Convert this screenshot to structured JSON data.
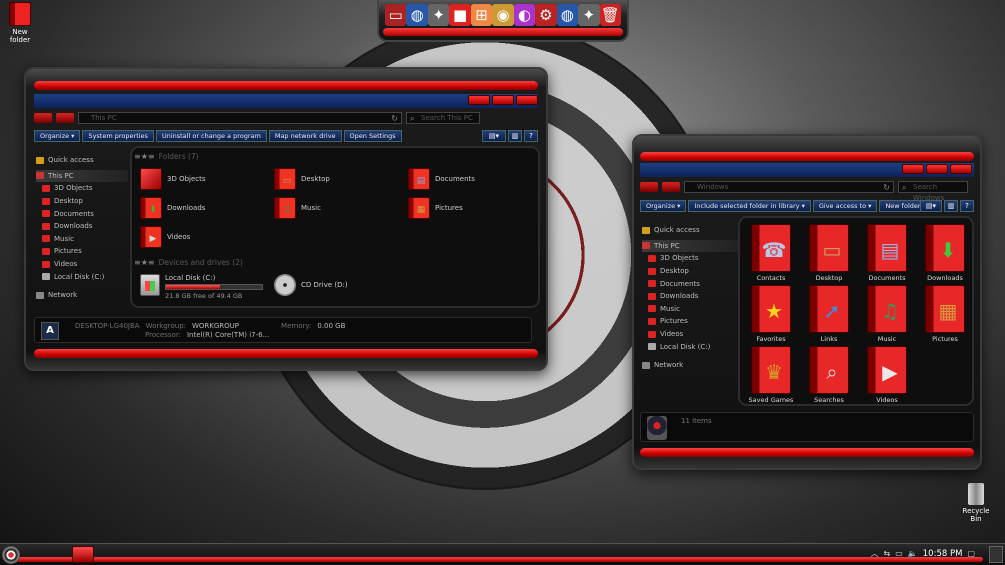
{
  "desktop": {
    "new_folder_label": "New folder",
    "recycle_bin_label": "Recycle Bin"
  },
  "dock": {
    "items": [
      "computer-icon",
      "globe-icon",
      "sparkle-icon",
      "red-app-icon",
      "windows-logo-icon",
      "chrome-icon",
      "rainbow-icon",
      "settings-icon",
      "globe-icon",
      "sparkle-icon",
      "trash-icon"
    ]
  },
  "thispc": {
    "address": "This PC",
    "search_placeholder": "Search This PC",
    "commands": [
      "Organize ▾",
      "System properties",
      "Uninstall or change a program",
      "Map network drive",
      "Open Settings"
    ],
    "nav": [
      {
        "label": "Quick access",
        "icon": "star-icon",
        "color": "#d4a017"
      },
      {
        "label": "This PC",
        "icon": "computer-icon",
        "color": "#c33"
      },
      {
        "label": "3D Objects",
        "icon": "cube-icon",
        "color": "#d22"
      },
      {
        "label": "Desktop",
        "icon": "desktop-icon",
        "color": "#d22"
      },
      {
        "label": "Documents",
        "icon": "document-icon",
        "color": "#d22"
      },
      {
        "label": "Downloads",
        "icon": "download-icon",
        "color": "#d22"
      },
      {
        "label": "Music",
        "icon": "music-icon",
        "color": "#d22"
      },
      {
        "label": "Pictures",
        "icon": "picture-icon",
        "color": "#d22"
      },
      {
        "label": "Videos",
        "icon": "video-icon",
        "color": "#d22"
      },
      {
        "label": "Local Disk (C:)",
        "icon": "disk-icon",
        "color": "#aaa"
      },
      {
        "label": "Network",
        "icon": "network-icon",
        "color": "#888"
      }
    ],
    "folders_title": "Folders (7)",
    "folders": [
      {
        "label": "3D Objects",
        "glyph": "■",
        "tint": "#ff6060"
      },
      {
        "label": "Desktop",
        "glyph": "▭",
        "tint": "#cfa060"
      },
      {
        "label": "Documents",
        "glyph": "▤",
        "tint": "#8aa6d8"
      },
      {
        "label": "Downloads",
        "glyph": "⬇",
        "tint": "#36b836"
      },
      {
        "label": "Music",
        "glyph": "♫",
        "tint": "#2e9b5a"
      },
      {
        "label": "Pictures",
        "glyph": "▦",
        "tint": "#d89a40"
      },
      {
        "label": "Videos",
        "glyph": "▶",
        "tint": "#d8d8d8"
      }
    ],
    "drives_title": "Devices and drives (2)",
    "drives": [
      {
        "label": "Local Disk (C:)",
        "free": "21.8 GB free of 49.4 GB",
        "used_fraction": 0.56
      },
      {
        "label": "CD Drive (D:)"
      }
    ],
    "details": {
      "computer_name": "DESKTOP-LG40JBA",
      "workgroup_label": "Workgroup:",
      "workgroup": "WORKGROUP",
      "memory_label": "Memory:",
      "memory": "0.00 GB",
      "processor_label": "Processor:",
      "processor": "Intel(R) Core(TM) i7-6..."
    }
  },
  "library": {
    "address": "Windows",
    "search_placeholder": "Search Windows",
    "commands": [
      "Organize ▾",
      "Include selected folder in library ▾",
      "Give access to ▾",
      "New folder"
    ],
    "nav": [
      {
        "label": "Quick access",
        "color": "#d4a017"
      },
      {
        "label": "This PC",
        "color": "#c33"
      },
      {
        "label": "3D Objects",
        "color": "#d22"
      },
      {
        "label": "Desktop",
        "color": "#d22"
      },
      {
        "label": "Documents",
        "color": "#d22"
      },
      {
        "label": "Downloads",
        "color": "#d22"
      },
      {
        "label": "Music",
        "color": "#d22"
      },
      {
        "label": "Pictures",
        "color": "#d22"
      },
      {
        "label": "Videos",
        "color": "#d22"
      },
      {
        "label": "Local Disk (C:)",
        "color": "#aaa"
      },
      {
        "label": "Network",
        "color": "#888"
      }
    ],
    "items": [
      {
        "label": "Contacts",
        "glyph": "☎",
        "tint": "#b8c8e8"
      },
      {
        "label": "Desktop",
        "glyph": "▭",
        "tint": "#cfa060"
      },
      {
        "label": "Documents",
        "glyph": "▤",
        "tint": "#9ab0e0"
      },
      {
        "label": "Downloads",
        "glyph": "⬇",
        "tint": "#3ccc3c"
      },
      {
        "label": "Favorites",
        "glyph": "★",
        "tint": "#ffd21e"
      },
      {
        "label": "Links",
        "glyph": "➚",
        "tint": "#3a8ee8"
      },
      {
        "label": "Music",
        "glyph": "♫",
        "tint": "#2e9b5a"
      },
      {
        "label": "Pictures",
        "glyph": "▦",
        "tint": "#d89a40"
      },
      {
        "label": "Saved Games",
        "glyph": "♛",
        "tint": "#d6a020"
      },
      {
        "label": "Searches",
        "glyph": "⌕",
        "tint": "#d8d8d8"
      },
      {
        "label": "Videos",
        "glyph": "▶",
        "tint": "#e8e8e8"
      }
    ],
    "status": "11 items"
  },
  "taskbar": {
    "clock": "10:58 PM"
  }
}
